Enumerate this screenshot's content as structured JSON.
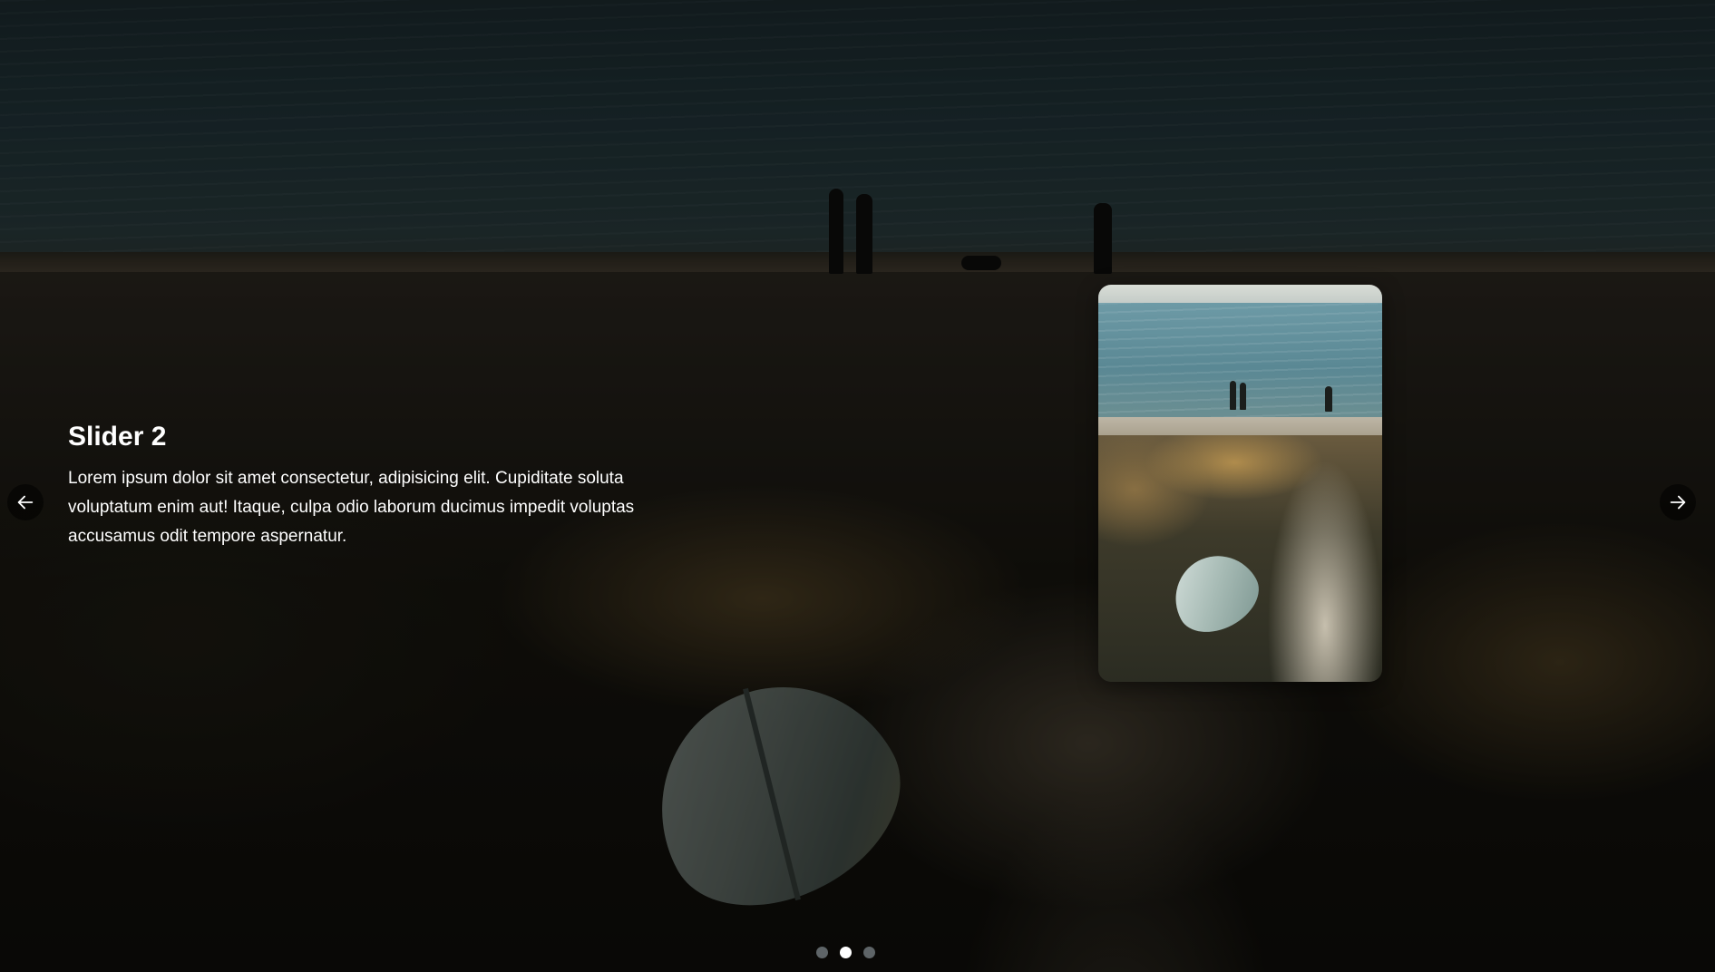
{
  "slide": {
    "title": "Slider 2",
    "description": "Lorem ipsum dolor sit amet consectetur, adipisicing elit. Cupiditate soluta voluptatum enim aut! Itaque, culpa odio laborum ducimus impedit voluptas accusamus odit tempore aspernatur."
  },
  "navigation": {
    "prev_icon": "arrow-left-icon",
    "next_icon": "arrow-right-icon"
  },
  "pagination": {
    "count": 3,
    "active_index": 1
  },
  "colors": {
    "text": "#ffffff",
    "dot_active": "#ffffff",
    "dot_inactive": "#8c969b"
  }
}
